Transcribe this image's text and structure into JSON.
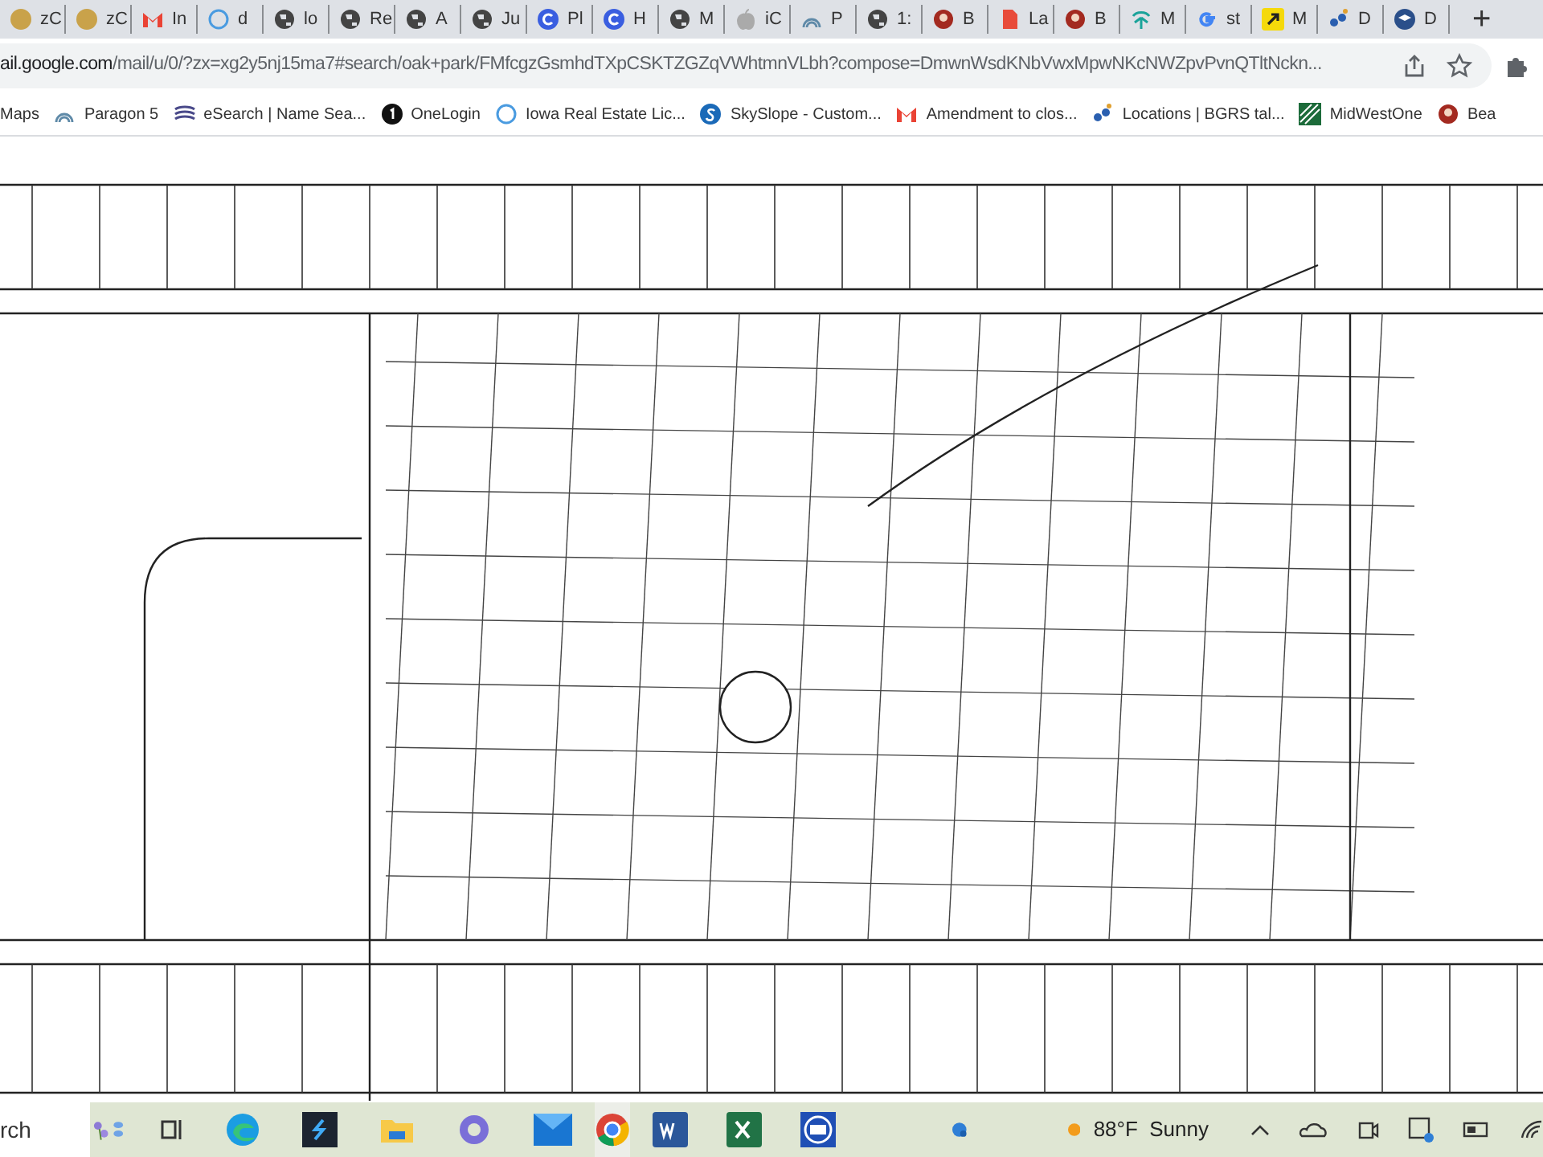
{
  "tabs": [
    {
      "label": "zC"
    },
    {
      "label": "zC"
    },
    {
      "label": "In"
    },
    {
      "label": "d"
    },
    {
      "label": "lo"
    },
    {
      "label": "Re"
    },
    {
      "label": "A"
    },
    {
      "label": "Ju"
    },
    {
      "label": "Pl"
    },
    {
      "label": "H"
    },
    {
      "label": "M"
    },
    {
      "label": "iC"
    },
    {
      "label": "P"
    },
    {
      "label": "1:"
    },
    {
      "label": "B"
    },
    {
      "label": "La"
    },
    {
      "label": "B"
    },
    {
      "label": "M"
    },
    {
      "label": "st"
    },
    {
      "label": "M"
    },
    {
      "label": "D"
    },
    {
      "label": "D"
    }
  ],
  "new_tab": "+",
  "address": {
    "host": "ail.google.com",
    "path": "/mail/u/0/?zx=xg2y5nj15ma7#search/oak+park/FMfcgzGsmhdTXpCSKTZGZqVWhtmnVLbh?compose=DmwnWsdKNbVwxMpwNKcNWZpvPvnQTltNckn..."
  },
  "bookmarks": [
    {
      "label": "Maps"
    },
    {
      "label": "Paragon 5"
    },
    {
      "label": "eSearch | Name Sea..."
    },
    {
      "label": "OneLogin"
    },
    {
      "label": "Iowa Real Estate Lic..."
    },
    {
      "label": "SkySlope - Custom..."
    },
    {
      "label": "Amendment to clos..."
    },
    {
      "label": "Locations | BGRS tal..."
    },
    {
      "label": "MidWestOne"
    },
    {
      "label": "Bea"
    }
  ],
  "taskbar": {
    "search": "rch",
    "weather": "88°F  Sunny"
  }
}
